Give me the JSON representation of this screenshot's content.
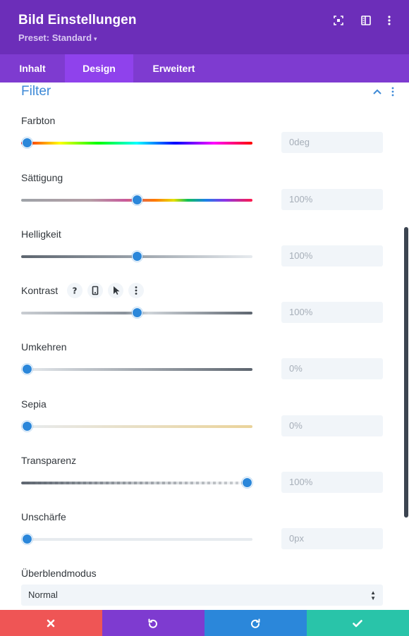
{
  "header": {
    "title": "Bild Einstellungen",
    "preset": "Preset: Standard",
    "icons": [
      "focus-icon",
      "sidebar-layout-icon",
      "more-vertical-icon"
    ],
    "background": "#6c2eb9"
  },
  "tabs": [
    {
      "label": "Inhalt",
      "active": false
    },
    {
      "label": "Design",
      "active": true
    },
    {
      "label": "Erweitert",
      "active": false
    }
  ],
  "section": {
    "title": "Filter",
    "icons": [
      "chevron-up-icon",
      "more-vertical-icon"
    ]
  },
  "filters": [
    {
      "label": "Farbton",
      "value": "0deg",
      "level": 0.0
    },
    {
      "label": "Sättigung",
      "value": "100%",
      "level": 0.5
    },
    {
      "label": "Helligkeit",
      "value": "100%",
      "level": 0.5
    },
    {
      "label": "Kontrast",
      "value": "100%",
      "level": 0.5,
      "option_icons": [
        "help-icon",
        "mobile-icon",
        "cursor-icon",
        "more-vertical-icon"
      ]
    },
    {
      "label": "Umkehren",
      "value": "0%",
      "level": 0.0
    },
    {
      "label": "Sepia",
      "value": "0%",
      "level": 0.0
    },
    {
      "label": "Transparenz",
      "value": "100%",
      "level": 1.0
    },
    {
      "label": "Unschärfe",
      "value": "0px",
      "level": 0.0
    }
  ],
  "blend": {
    "label": "Überblendmodus",
    "selected": "Normal"
  },
  "footer": {
    "buttons": [
      {
        "icon": "close-icon",
        "color": "#ef5555"
      },
      {
        "icon": "undo-icon",
        "color": "#7e3bd0"
      },
      {
        "icon": "redo-icon",
        "color": "#2b87da"
      },
      {
        "icon": "check-icon",
        "color": "#29c4a9"
      }
    ]
  },
  "colors": {
    "accent": "#2b87da",
    "section_title": "#3e8ad7",
    "input_bg": "#f1f5f9"
  }
}
